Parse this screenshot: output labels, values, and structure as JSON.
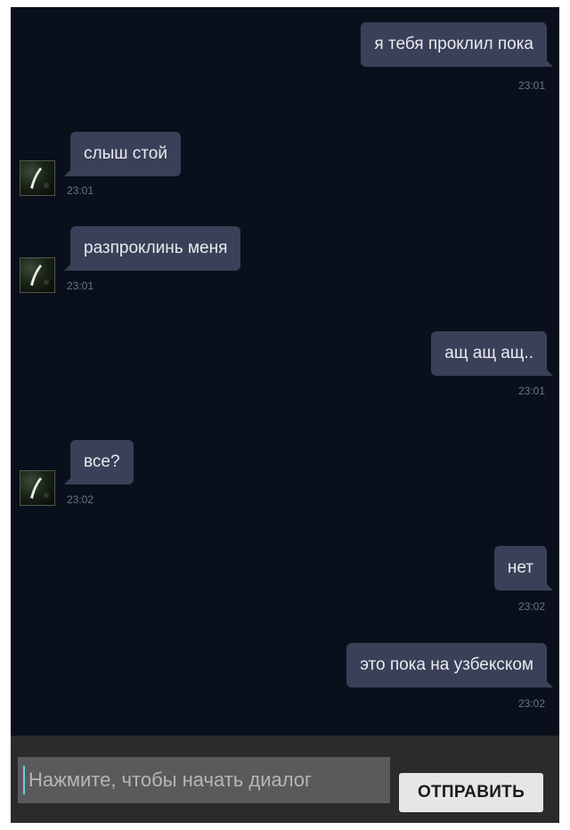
{
  "messages": [
    {
      "side": "out",
      "text": "я тебя проклил пока",
      "time": "23:01"
    },
    {
      "side": "in",
      "text": "слыш стой",
      "time": "23:01"
    },
    {
      "side": "in",
      "text": "разпроклинь меня",
      "time": "23:01"
    },
    {
      "side": "out",
      "text": "ащ ащ ащ..",
      "time": "23:01"
    },
    {
      "side": "in",
      "text": "все?",
      "time": "23:02"
    },
    {
      "side": "out",
      "text": "нет",
      "time": "23:02"
    },
    {
      "side": "out",
      "text": "это пока на узбекском",
      "time": "23:02"
    }
  ],
  "composer": {
    "placeholder": "Нажмите, чтобы начать диалог",
    "send_label": "ОТПРАВИТЬ"
  },
  "colors": {
    "background": "#0a101b",
    "bubble": "#3a4057",
    "composer": "#2b2b2d"
  }
}
